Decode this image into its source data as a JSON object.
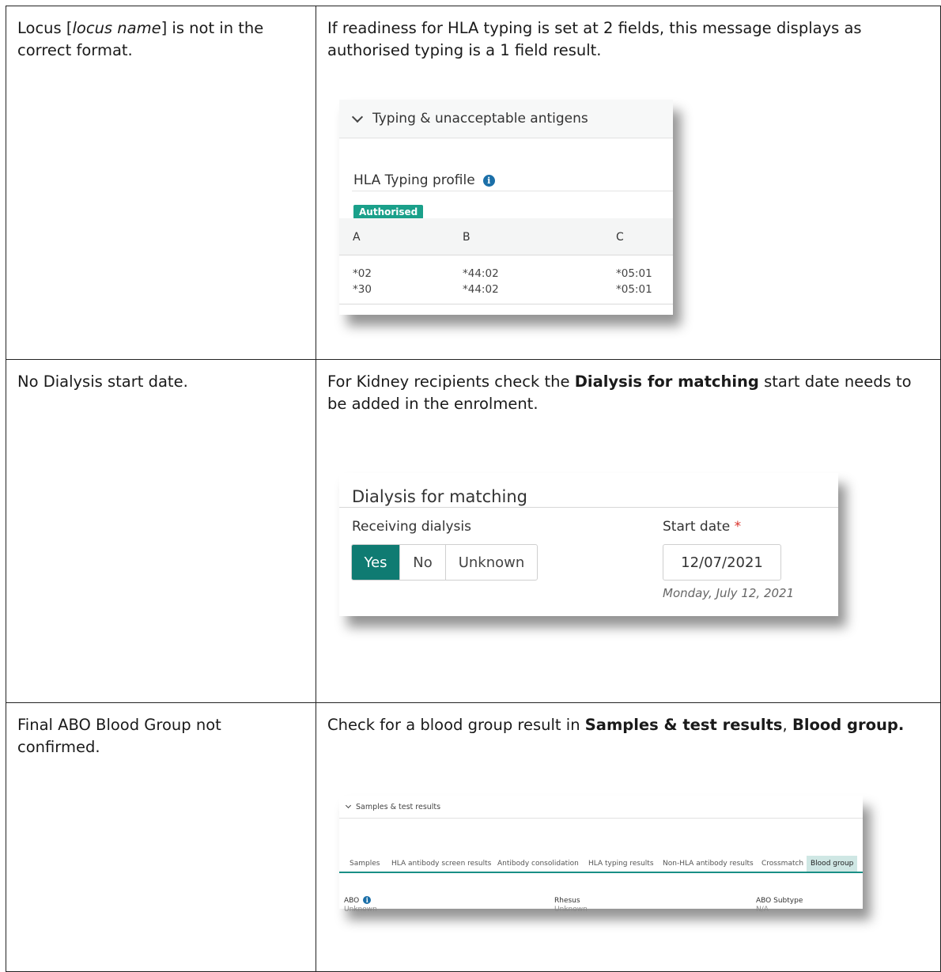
{
  "rows": [
    {
      "issue_pre": "Locus [",
      "issue_em": "locus name",
      "issue_post": "] is not in the correct format.",
      "resolution": "If readiness for HLA typing is set at 2 fields, this message displays as authorised typing is a 1 field result."
    },
    {
      "issue": "No Dialysis start date.",
      "resolution_pre": "For Kidney recipients check the ",
      "resolution_bold": "Dialysis for matching",
      "resolution_post": " start date needs to be added in the enrolment."
    },
    {
      "issue": "Final ABO Blood Group not confirmed.",
      "resolution_pre": "Check for a blood group result in ",
      "resolution_bold1": "Samples & test results",
      "resolution_mid": ", ",
      "resolution_bold2": "Blood group."
    }
  ],
  "hla_panel": {
    "section_title": "Typing & unacceptable antigens",
    "profile_title": "HLA Typing profile",
    "info_glyph": "i",
    "status_badge": "Authorised",
    "status_color": "#1aa08a",
    "columns": [
      "A",
      "B",
      "C"
    ],
    "rows": [
      [
        "*02",
        "*44:02",
        "*05:01"
      ],
      [
        "*30",
        "*44:02",
        "*05:01"
      ]
    ]
  },
  "dialysis_panel": {
    "title": "Dialysis for matching",
    "receiving_label": "Receiving dialysis",
    "options": [
      "Yes",
      "No",
      "Unknown"
    ],
    "selected": "Yes",
    "accent": "#0f7b72",
    "start_date_label": "Start date",
    "required_marker": "*",
    "start_date_value": "12/07/2021",
    "start_date_hint": "Monday, July 12, 2021"
  },
  "samples_panel": {
    "section_title": "Samples & test results",
    "tabs": [
      "Samples",
      "HLA antibody screen results",
      "Antibody consolidation",
      "HLA typing results",
      "Non-HLA antibody results",
      "Crossmatch",
      "Blood group"
    ],
    "active_tab": "Blood group",
    "fields": [
      {
        "label": "ABO",
        "value": "Unknown"
      },
      {
        "label": "Rhesus",
        "value": "Unknown"
      },
      {
        "label": "ABO Subtype",
        "value": "N/A"
      }
    ]
  }
}
